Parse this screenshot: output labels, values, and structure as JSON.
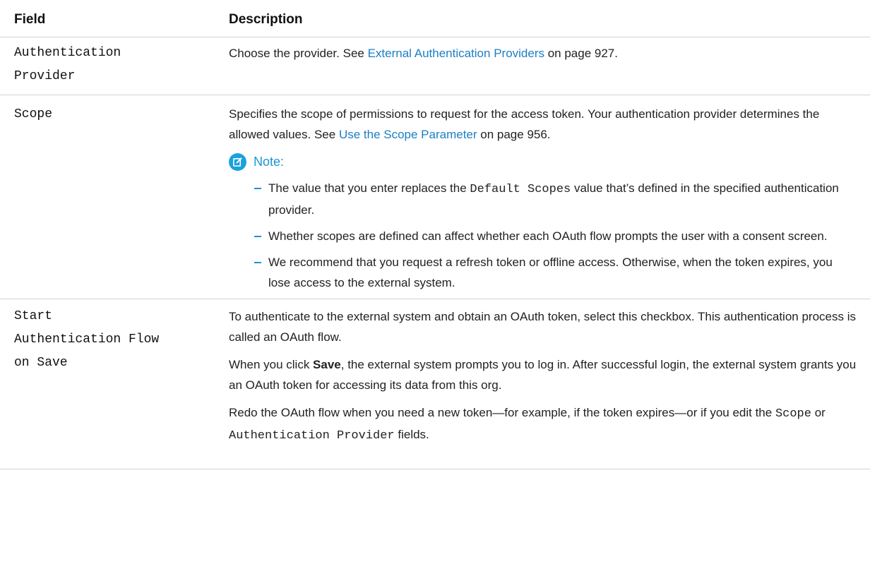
{
  "table": {
    "headers": {
      "field": "Field",
      "description": "Description"
    },
    "rows": [
      {
        "field_lines": [
          "Authentication",
          "Provider"
        ],
        "desc": {
          "prefix": "Choose the provider. See ",
          "link": "External Authentication Providers",
          "suffix": " on page 927."
        }
      },
      {
        "field_lines": [
          "Scope"
        ],
        "desc": {
          "text1": "Specifies the scope of permissions to request for the access token. Your authentication provider determines the allowed values. See ",
          "link": "Use the Scope Parameter",
          "suffix": " on page 956.",
          "note_label": "Note:",
          "bullets": [
            {
              "pre": "The value that you enter replaces the ",
              "code": "Default Scopes",
              "post": " value that’s defined in the specified authentication provider."
            },
            {
              "text": "Whether scopes are defined can affect whether each OAuth flow prompts the user with a consent screen."
            },
            {
              "text": "We recommend that you request a refresh token or offline access. Otherwise, when the token expires, you lose access to the external system."
            }
          ]
        }
      },
      {
        "field_lines": [
          "Start",
          "Authentication Flow",
          "on Save"
        ],
        "desc": {
          "p1": "To authenticate to the external system and obtain an OAuth token, select this checkbox. This authentication process is called an OAuth flow.",
          "p2_pre": "When you click ",
          "p2_bold": "Save",
          "p2_post": ", the external system prompts you to log in. After successful login, the external system grants you an OAuth token for accessing its data from this org.",
          "p3_pre": "Redo the OAuth flow when you need a new token—for example, if the token expires—or if you edit the ",
          "p3_code1": "Scope",
          "p3_mid": " or ",
          "p3_code2": "Authentication Provider",
          "p3_post": " fields."
        }
      }
    ]
  },
  "colors": {
    "link": "#1b7fc4",
    "note_accent": "#1aa1e0",
    "rule": "#d4d4d4"
  },
  "icons": {
    "note": "note-edit-icon"
  }
}
